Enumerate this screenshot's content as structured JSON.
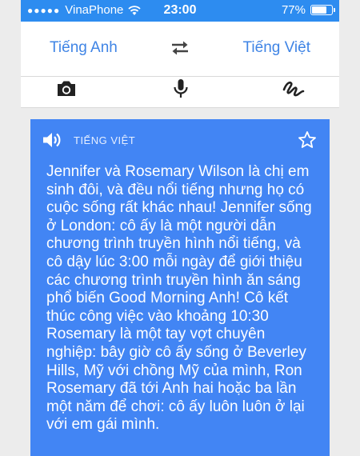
{
  "status": {
    "carrier": "VinaPhone",
    "signal_dots": "●●●●●",
    "time": "23:00",
    "battery_text": "77%",
    "battery_level": 0.77
  },
  "languages": {
    "source": "Tiếng Anh",
    "target": "Tiếng Việt"
  },
  "icons": {
    "swap": "swap-arrows-icon",
    "camera": "camera-icon",
    "mic": "microphone-icon",
    "handwriting": "handwriting-icon",
    "speaker": "speaker-icon",
    "star": "star-icon"
  },
  "translation": {
    "language_label": "TIẾNG VIỆT",
    "text": "Jennifer và Rosemary Wilson là chị em sinh đôi, và đều nổi tiếng nhưng họ có cuộc sống rất khác nhau! Jennifer sống ở London: cô ấy là một người dẫn chương trình truyền hình nổi tiếng, và cô dậy lúc 3:00 mỗi ngày để giới thiệu các chương trình truyền hình ăn sáng phổ biến Good Morning Anh! Cô kết thúc công việc vào khoảng 10:30 Rosemary là một tay vợt chuyên nghiệp: bây giờ cô ấy sống ở Beverley Hills, Mỹ với chồng Mỹ của mình, Ron Rosemary đã tới Anh hai hoặc ba lần một năm để chơi: cô ấy luôn luôn ở lại với em gái mình."
  },
  "colors": {
    "status_bar": "#2d8cf0",
    "accent_text": "#3f84e5",
    "card": "#4285f4"
  }
}
